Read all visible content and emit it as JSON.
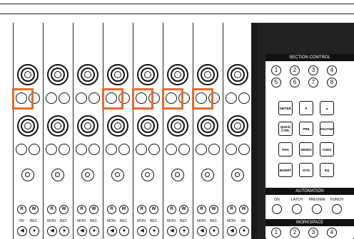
{
  "section_control": {
    "title": "SECTION CONTROL",
    "numbers": [
      "1",
      "2",
      "3",
      "4",
      "5",
      "6",
      "7",
      "8"
    ],
    "buttons": [
      "METER",
      "▼",
      "▲",
      "QUICK CTRL",
      "PRE",
      "ROUTING",
      "PAN",
      "SENDS",
      "CUES",
      "INSERT",
      "DYN",
      "EQ"
    ]
  },
  "automation": {
    "title": "AUTOMATION",
    "modes": [
      "ON",
      "LATCH",
      "PREVIEW",
      "PUNCH"
    ]
  },
  "workspace": {
    "title": "WORKSPACE",
    "numbers": [
      "1",
      "2",
      "3",
      "4"
    ]
  },
  "strip": {
    "read_label": "R",
    "write_label": "W",
    "on_label": "ON",
    "mon_label": "MON",
    "rec_label": "REC",
    "rec_label_partial": "RE"
  },
  "colors": {
    "highlight": "#e8692d",
    "panel": "#222222"
  }
}
